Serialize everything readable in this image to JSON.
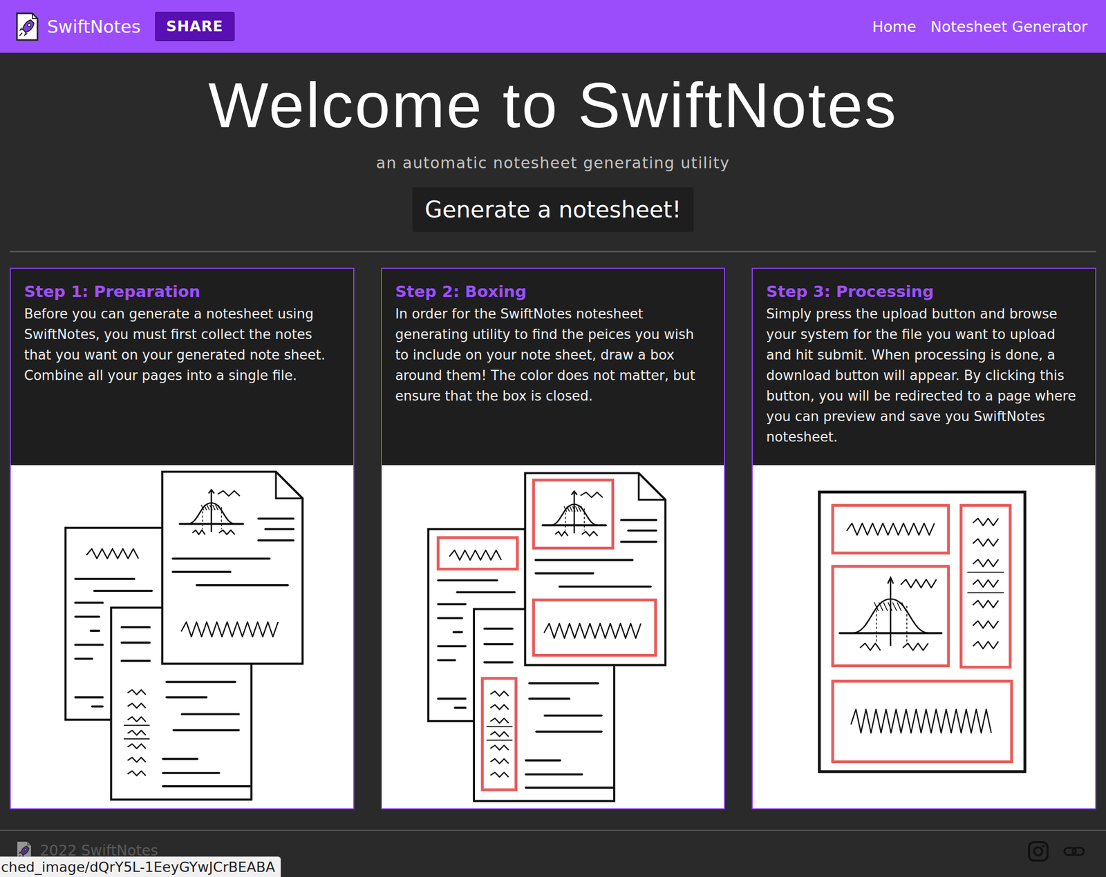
{
  "navbar": {
    "brand": "SwiftNotes",
    "share": "SHARE",
    "links": [
      {
        "label": "Home"
      },
      {
        "label": "Notesheet Generator"
      }
    ]
  },
  "hero": {
    "title": "Welcome to SwiftNotes",
    "subtitle": "an automatic notesheet generating utility",
    "button": "Generate a notesheet!"
  },
  "steps": [
    {
      "title": "Step 1: Preparation",
      "text": "Before you can generate a notesheet using SwiftNotes, you must first collect the notes that you want on your generated note sheet. Combine all your pages into a single file.",
      "kind": "pages"
    },
    {
      "title": "Step 2: Boxing",
      "text": "In order for the SwiftNotes notesheet generating utility to find the peices you wish to include on your note sheet, draw a box around them! The color does not matter, but ensure that the box is closed.",
      "kind": "boxed"
    },
    {
      "title": "Step 3: Processing",
      "text": "Simply press the upload button and browse your system for the file you want to upload and hit submit. When processing is done, a download button will appear. By clicking this button, you will be redirected to a page where you can preview and save you SwiftNotes notesheet.",
      "kind": "sheet"
    }
  ],
  "footer": {
    "copyright": "2022 SwiftNotes"
  },
  "status_bar": {
    "url": "ched_image/dQrY5L-1EeyGYwJCrBEABA"
  }
}
